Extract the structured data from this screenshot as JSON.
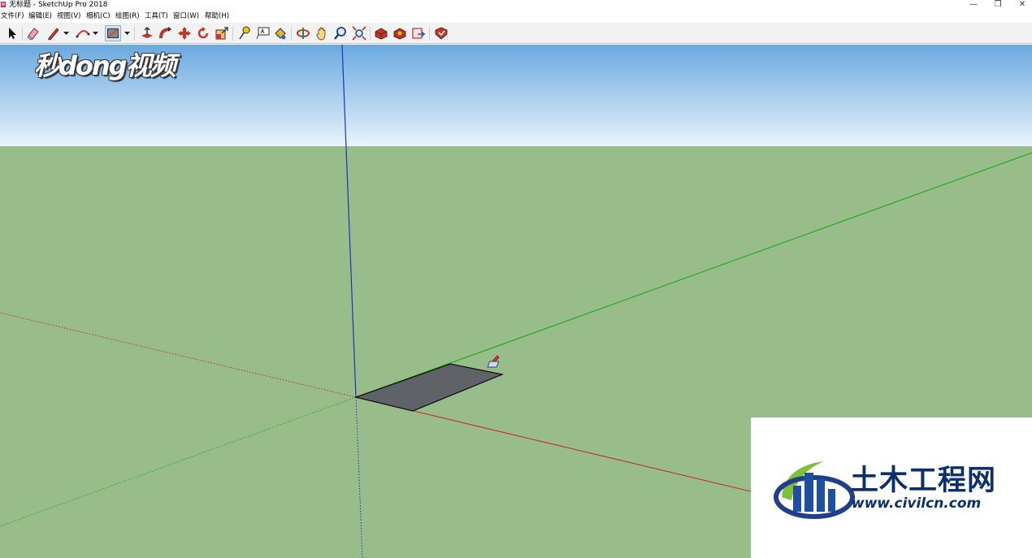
{
  "window": {
    "title": "无标题 - SketchUp Pro 2018",
    "controls": {
      "minimize": "—",
      "restore": "❐",
      "close": "✕"
    }
  },
  "menubar": {
    "items": [
      "文件(F)",
      "编辑(E)",
      "视图(V)",
      "相机(C)",
      "绘图(R)",
      "工具(T)",
      "窗口(W)",
      "帮助(H)"
    ]
  },
  "toolbar": {
    "tools": [
      "select-tool",
      "eraser-tool",
      "line-tool",
      "arc-tool",
      "rectangle-tool",
      "push-pull-tool",
      "follow-me-tool",
      "move-tool",
      "rotate-tool",
      "scale-tool",
      "tape-measure-tool",
      "text-tool",
      "paint-bucket-tool",
      "orbit-tool",
      "pan-tool",
      "zoom-tool",
      "zoom-extents-tool",
      "3d-warehouse-tool",
      "extension-warehouse-tool",
      "layout-send-tool",
      "extension-manager-tool"
    ],
    "active_tool": "rectangle-tool"
  },
  "viewport": {
    "colors": {
      "sky_top": "#6aa9e0",
      "sky_bottom": "#e9f3fb",
      "ground": "#98bd8a",
      "blue_axis": "#1f34b8",
      "green_axis": "#1aa81a",
      "red_axis": "#c4302b",
      "face": "#5f6266"
    },
    "cursor": "rectangle-cursor-icon"
  },
  "watermarks": {
    "left": "秒dong视频",
    "right_cn": "土木工程网",
    "right_url": "www.civilcn.com"
  }
}
